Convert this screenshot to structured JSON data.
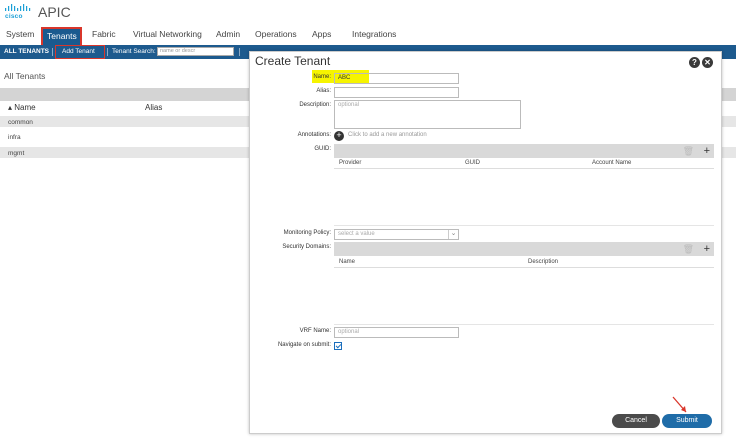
{
  "header": {
    "brand": "cisco",
    "app_title": "APIC"
  },
  "main_tabs": [
    {
      "label": "System"
    },
    {
      "label": "Tenants"
    },
    {
      "label": "Fabric"
    },
    {
      "label": "Virtual Networking"
    },
    {
      "label": "Admin"
    },
    {
      "label": "Operations"
    },
    {
      "label": "Apps"
    },
    {
      "label": "Integrations"
    }
  ],
  "sub_nav": {
    "all_tenants": "ALL TENANTS",
    "add_tenant": "Add Tenant",
    "search_label": "Tenant Search:",
    "search_placeholder": "name or descr"
  },
  "background_list": {
    "title": "All Tenants",
    "columns": [
      "Name",
      "Alias"
    ],
    "rows": [
      "common",
      "infra",
      "mgmt"
    ]
  },
  "modal": {
    "title": "Create Tenant",
    "help_icon": "?",
    "close_icon": "✕",
    "fields": {
      "name_label": "Name:",
      "name_value": "ABC",
      "alias_label": "Alias:",
      "alias_value": "",
      "description_label": "Description:",
      "description_placeholder": "optional",
      "annotations_label": "Annotations:",
      "annotations_hint": "Click to add a new annotation",
      "guid_label": "GUID:",
      "monitoring_label": "Monitoring Policy:",
      "monitoring_placeholder": "select a value",
      "security_label": "Security Domains:",
      "vrf_label": "VRF Name:",
      "vrf_placeholder": "optional",
      "navigate_label": "Navigate on submit:",
      "navigate_checked": true
    },
    "guid_table": {
      "columns": [
        "Provider",
        "GUID",
        "Account Name"
      ]
    },
    "security_table": {
      "columns": [
        "Name",
        "Description"
      ]
    },
    "buttons": {
      "cancel": "Cancel",
      "submit": "Submit"
    }
  },
  "colors": {
    "nav_blue": "#1d5a8e",
    "highlight_red": "#d9362b",
    "highlight_yellow": "#f6f400",
    "submit_blue": "#1f6ca8",
    "cancel_gray": "#4b4b4b"
  }
}
